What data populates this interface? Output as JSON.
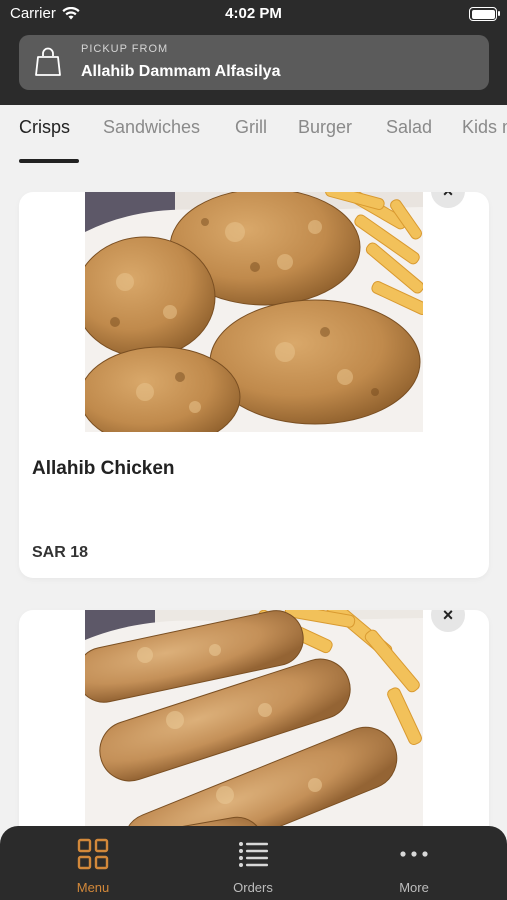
{
  "status_bar": {
    "carrier": "Carrier",
    "time": "4:02 PM"
  },
  "pickup": {
    "label": "PICKUP FROM",
    "location": "Allahib Dammam Alfasilya"
  },
  "categories": [
    {
      "label": "Crisps",
      "active": true
    },
    {
      "label": "Sandwiches",
      "active": false
    },
    {
      "label": "Grill",
      "active": false
    },
    {
      "label": "Burger",
      "active": false
    },
    {
      "label": "Salad",
      "active": false
    },
    {
      "label": "Kids m",
      "active": false
    }
  ],
  "menu_items": [
    {
      "name": "Allahib Chicken",
      "price": "SAR 18",
      "image": "fried-chicken-pieces-with-fries"
    },
    {
      "name": "",
      "price": "",
      "image": "chicken-strips-with-fries"
    }
  ],
  "tabbar": {
    "items": [
      {
        "label": "Menu",
        "icon": "grid-icon",
        "active": true
      },
      {
        "label": "Orders",
        "icon": "list-icon",
        "active": false
      },
      {
        "label": "More",
        "icon": "ellipsis-icon",
        "active": false
      }
    ]
  },
  "colors": {
    "header_bg": "#2b2b2b",
    "accent": "#d2883a",
    "page_bg": "#f1f1f1"
  }
}
